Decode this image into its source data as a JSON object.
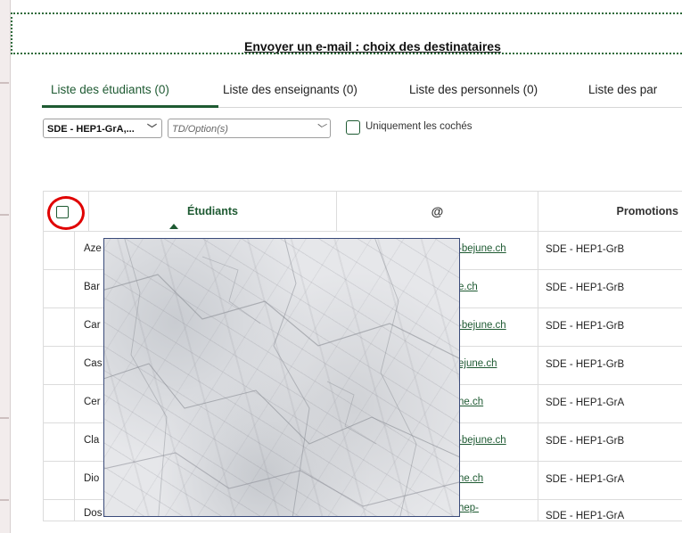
{
  "dialog": {
    "title": "Envoyer un e-mail : choix des destinataires"
  },
  "tabs": [
    {
      "label": "Liste des étudiants (0)",
      "active": true
    },
    {
      "label": "Liste des enseignants (0)",
      "active": false
    },
    {
      "label": "Liste des personnels (0)",
      "active": false
    },
    {
      "label": "Liste des par",
      "active": false
    }
  ],
  "filters": {
    "class_select": "SDE - HEP1-GrA,...",
    "option_select_placeholder": "TD/Option(s)",
    "only_checked_label": "Uniquement les cochés",
    "only_checked": false
  },
  "table": {
    "columns": [
      "Étudiants",
      "@",
      "Promotions"
    ],
    "header_checkbox_checked": false,
    "rows": [
      {
        "name": "Aze",
        "email": "-bejune.ch",
        "promotion": "SDE - HEP1-GrB"
      },
      {
        "name": "Bar",
        "email": "e.ch",
        "promotion": "SDE - HEP1-GrB"
      },
      {
        "name": "Car",
        "email": "-bejune.ch",
        "promotion": "SDE - HEP1-GrB"
      },
      {
        "name": "Cas",
        "email": "ejune.ch",
        "promotion": "SDE - HEP1-GrB"
      },
      {
        "name": "Cer",
        "email": "ne.ch",
        "promotion": "SDE - HEP1-GrA"
      },
      {
        "name": "Cla",
        "email": "-bejune.ch",
        "promotion": "SDE - HEP1-GrB"
      },
      {
        "name": "Dio",
        "email": "ne.ch",
        "promotion": "SDE - HEP1-GrA"
      },
      {
        "name": "Dos",
        "email": "hep-",
        "promotion": "SDE - HEP1-GrA"
      }
    ]
  },
  "colors": {
    "accent": "#1e5a32",
    "highlight": "#e00000"
  }
}
